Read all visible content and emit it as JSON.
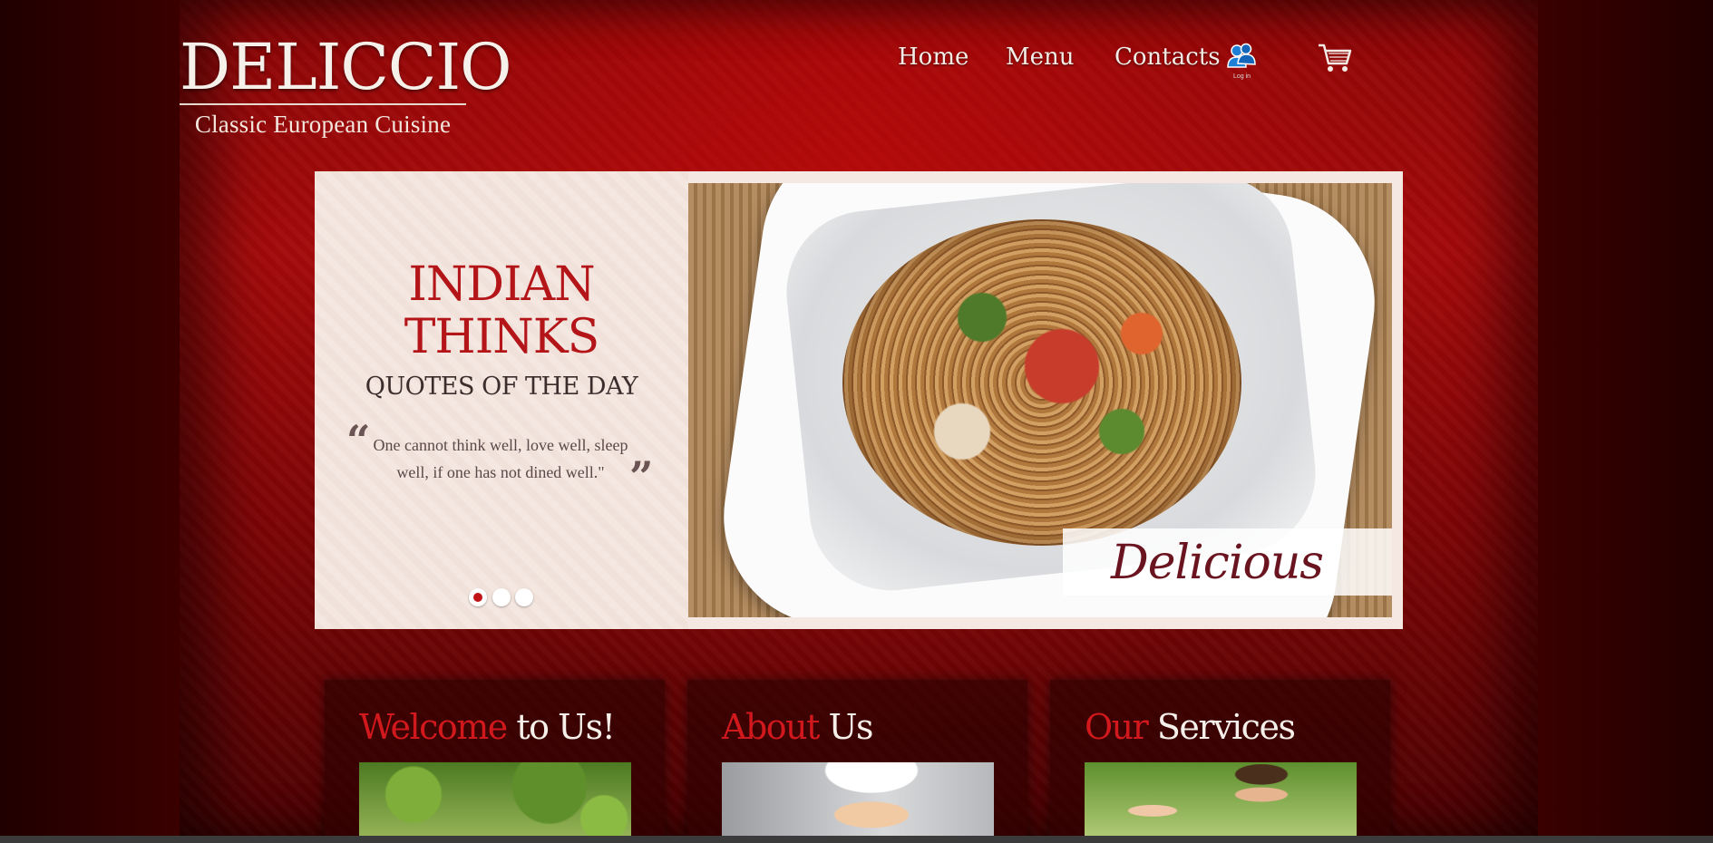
{
  "brand": {
    "name": "DELICCIO",
    "tagline": "Classic European Cuisine"
  },
  "nav": {
    "items": [
      {
        "label": "Home"
      },
      {
        "label": "Menu"
      },
      {
        "label": "Contacts"
      }
    ],
    "login_label": "Log in"
  },
  "slider": {
    "headline_line1": "INDIAN",
    "headline_line2": "THINKS",
    "subhead": "QUOTES OF THE DAY",
    "quote": "One cannot think well, love well, sleep well, if one has not dined well.\"",
    "image_caption": "Delicious",
    "slide_count": 3,
    "active_slide": 1
  },
  "sections": [
    {
      "accent": "Welcome",
      "rest": " to Us!"
    },
    {
      "accent": "About",
      "rest": " Us"
    },
    {
      "accent": "Our",
      "rest": " Services"
    }
  ],
  "colors": {
    "accent_red": "#d1181c",
    "background_red": "#a40a0b",
    "cream": "#f5e8e2"
  }
}
